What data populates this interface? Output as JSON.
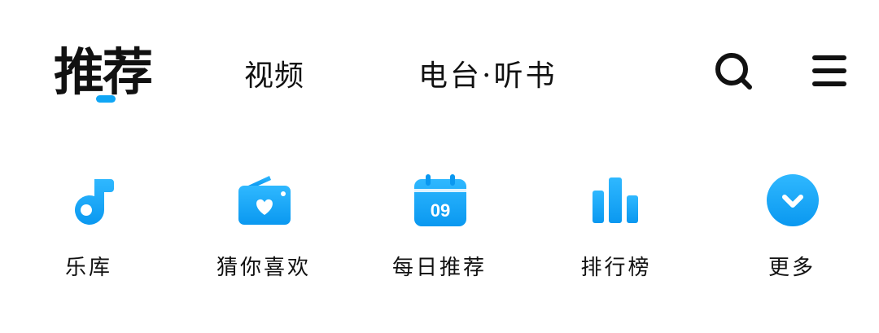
{
  "header": {
    "tabs": [
      {
        "label": "推荐",
        "active": true
      },
      {
        "label": "视频",
        "active": false
      },
      {
        "label": "电台·听书",
        "active": false
      }
    ],
    "search_icon": "search-icon",
    "menu_icon": "hamburger-menu-icon"
  },
  "shortcuts": [
    {
      "label": "乐库",
      "icon": "music-note-icon"
    },
    {
      "label": "猜你喜欢",
      "icon": "heart-radio-icon"
    },
    {
      "label": "每日推荐",
      "icon": "calendar-icon",
      "icon_text": "09"
    },
    {
      "label": "排行榜",
      "icon": "bar-chart-icon"
    },
    {
      "label": "更多",
      "icon": "chevron-down-circle-icon"
    }
  ],
  "colors": {
    "accent": "#10a6f5",
    "accent_light": "#2fb8ff",
    "text": "#111111",
    "background": "#ffffff"
  }
}
